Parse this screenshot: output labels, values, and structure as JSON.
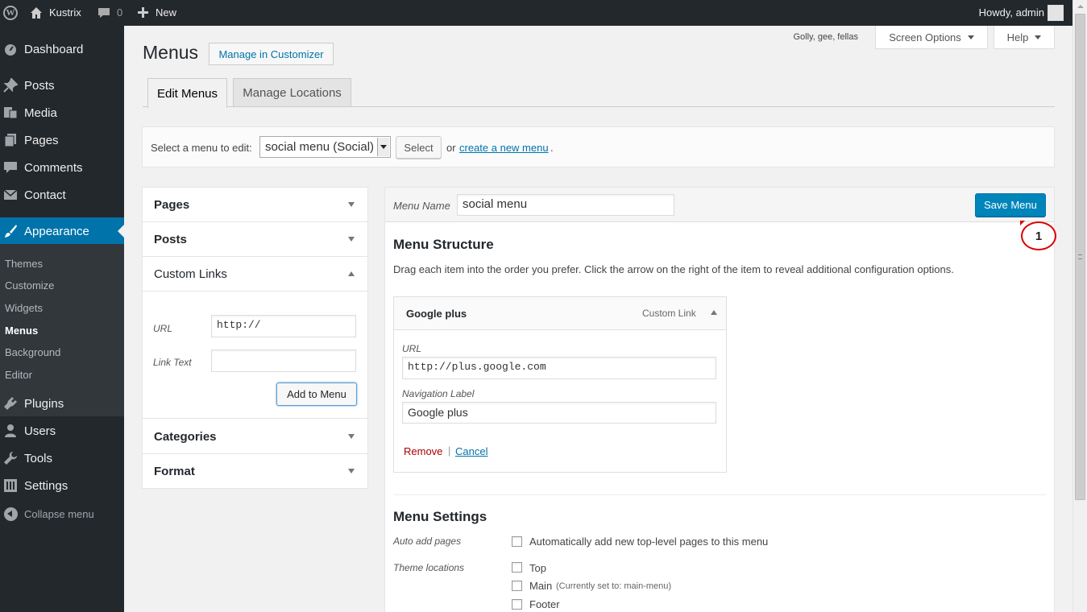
{
  "adminbar": {
    "site_name": "Kustrix",
    "comment_count": "0",
    "new_label": "New",
    "howdy": "Howdy, admin"
  },
  "sidebar": {
    "items": [
      {
        "label": "Dashboard",
        "icon": "dashboard-icon"
      },
      {
        "label": "Posts",
        "icon": "pin-icon"
      },
      {
        "label": "Media",
        "icon": "media-icon"
      },
      {
        "label": "Pages",
        "icon": "pages-icon"
      },
      {
        "label": "Comments",
        "icon": "comment-icon"
      },
      {
        "label": "Contact",
        "icon": "mail-icon"
      },
      {
        "label": "Appearance",
        "icon": "brush-icon"
      },
      {
        "label": "Plugins",
        "icon": "plug-icon"
      },
      {
        "label": "Users",
        "icon": "user-icon"
      },
      {
        "label": "Tools",
        "icon": "wrench-icon"
      },
      {
        "label": "Settings",
        "icon": "settings-icon"
      }
    ],
    "submenu": [
      "Themes",
      "Customize",
      "Widgets",
      "Menus",
      "Background",
      "Editor"
    ],
    "collapse_label": "Collapse menu"
  },
  "header": {
    "title": "Menus",
    "customizer_button": "Manage in Customizer",
    "golly": "Golly, gee, fellas",
    "screen_options": "Screen Options",
    "help": "Help"
  },
  "tabs": [
    {
      "label": "Edit Menus",
      "active": true
    },
    {
      "label": "Manage Locations",
      "active": false
    }
  ],
  "manage": {
    "label": "Select a menu to edit:",
    "selected": "social menu (Social)",
    "select_button": "Select",
    "or_text": "or",
    "create_link": "create a new menu",
    "period": "."
  },
  "accordion": {
    "sections": [
      "Pages",
      "Posts",
      "Custom Links",
      "Categories",
      "Format"
    ],
    "url_label": "URL",
    "url_value": "http://",
    "link_text_label": "Link Text",
    "link_text_value": "",
    "add_button": "Add to Menu"
  },
  "menu": {
    "name_label": "Menu Name",
    "name_value": "social menu",
    "save_button": "Save Menu",
    "structure_title": "Menu Structure",
    "structure_desc": "Drag each item into the order you prefer. Click the arrow on the right of the item to reveal additional configuration options.",
    "item": {
      "title": "Google plus",
      "type": "Custom Link",
      "url_label": "URL",
      "url_value": "http://plus.google.com",
      "nav_label": "Navigation Label",
      "nav_value": "Google plus",
      "remove": "Remove",
      "separator": "|",
      "cancel": "Cancel"
    },
    "settings_title": "Menu Settings",
    "auto_add_label": "Auto add pages",
    "auto_add_text": "Automatically add new top-level pages to this menu",
    "theme_locations_label": "Theme locations",
    "locations": [
      {
        "name": "Top",
        "note": ""
      },
      {
        "name": "Main",
        "note": "(Currently set to: main-menu)"
      },
      {
        "name": "Footer",
        "note": ""
      }
    ]
  },
  "annotation": "1",
  "colors": {
    "adminbar": "#23282d",
    "sidebar_active": "#0073aa",
    "primary_button": "#0085ba",
    "annotation": "#dd0000"
  }
}
